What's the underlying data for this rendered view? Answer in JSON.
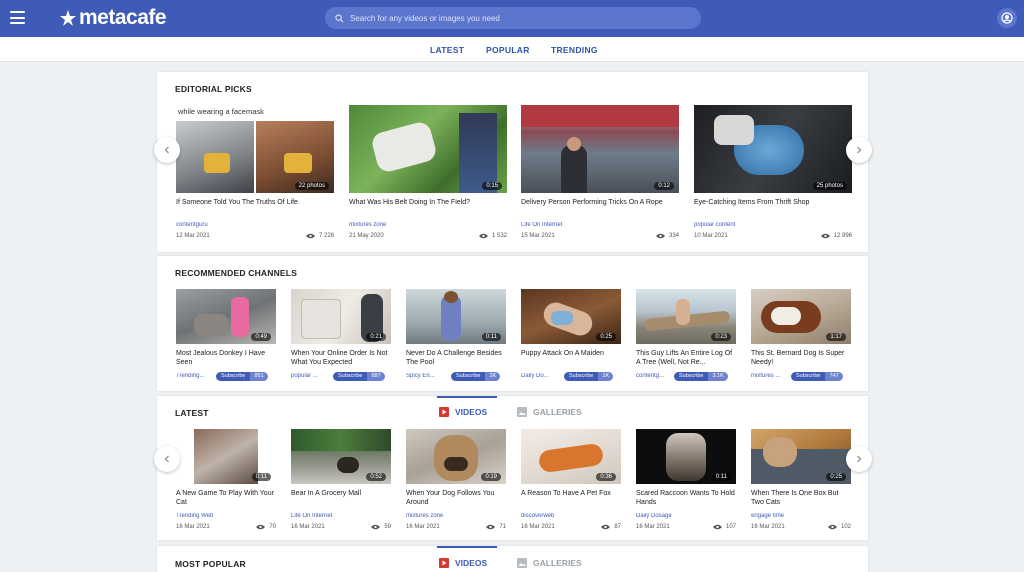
{
  "header": {
    "logo": "metacafe",
    "search_placeholder": "Search for any videos or images you need"
  },
  "subnav": {
    "latest": "LATEST",
    "popular": "POPULAR",
    "trending": "TRENDING"
  },
  "editorial": {
    "title": "EDITORIAL PICKS",
    "items": [
      {
        "title": "If Someone Told You The Truths Of Life",
        "source": "contentguru",
        "date": "12 Mar 2021",
        "views": "7 228",
        "badge": "22 photos",
        "overlay": "while wearing a facemask"
      },
      {
        "title": "What Was His Belt Doing In The Field?",
        "source": "mixtures zone",
        "date": "21 May 2020",
        "views": "1 532",
        "badge": "0:15"
      },
      {
        "title": "Delivery Person Performing Tricks On A Rope",
        "source": "Life On Internet",
        "date": "15 Mar 2021",
        "views": "334",
        "badge": "0:12"
      },
      {
        "title": "Eye-Catching Items From Thrift Shop",
        "source": "popular content",
        "date": "10 Mar 2021",
        "views": "12 996",
        "badge": "25 photos"
      }
    ]
  },
  "channels": {
    "title": "RECOMMENDED CHANNELS",
    "subscribe_label": "Subscribe",
    "items": [
      {
        "title": "Most Jealous Donkey I Have Seen",
        "source": "Trending...",
        "count": "851",
        "badge": "0:49"
      },
      {
        "title": "When Your Online Order Is Not What You Expected",
        "source": "popular ...",
        "count": "887",
        "badge": "0:21"
      },
      {
        "title": "Never Do A Challenge Besides The Pool",
        "source": "Spicy En...",
        "count": "2K",
        "badge": "0:11"
      },
      {
        "title": "Puppy Attack On A Maiden",
        "source": "Daily Do...",
        "count": "1K",
        "badge": "0:25"
      },
      {
        "title": "This Guy Lifts An Entire Log Of A Tree (Well, Not Re...",
        "source": "contentg...",
        "count": "3.1K",
        "badge": "0:23"
      },
      {
        "title": "This St. Bernard Dog Is Super Needy!",
        "source": "mixtures ...",
        "count": "747",
        "badge": "1:17"
      }
    ]
  },
  "latest": {
    "title": "LATEST",
    "tab_videos": "VIDEOS",
    "tab_galleries": "GALLERIES",
    "items": [
      {
        "title": "A New Game To Play With Your Cat",
        "source": "Trending Web",
        "date": "16 Mar 2021",
        "views": "70",
        "badge": "0:11"
      },
      {
        "title": "Bear In A Grocery Mall",
        "source": "Life On Internet",
        "date": "16 Mar 2021",
        "views": "59",
        "badge": "0:52"
      },
      {
        "title": "When Your Dog Follows You Around",
        "source": "mixtures zone",
        "date": "16 Mar 2021",
        "views": "71",
        "badge": "0:19"
      },
      {
        "title": "A Reason To Have A Pet Fox",
        "source": "discoverweb",
        "date": "16 Mar 2021",
        "views": "87",
        "badge": "0:36"
      },
      {
        "title": "Scared Raccoon Wants To Hold Hands",
        "source": "Daily Dosage",
        "date": "16 Mar 2021",
        "views": "107",
        "badge": "0:11"
      },
      {
        "title": "When There Is One Box But Two Cats",
        "source": "engage time",
        "date": "16 Mar 2021",
        "views": "102",
        "badge": "0:25"
      }
    ]
  },
  "popular": {
    "title": "MOST POPULAR",
    "tab_videos": "VIDEOS",
    "tab_galleries": "GALLERIES"
  },
  "colors": {
    "brand": "#3f5bb8",
    "search": "#5b76cc",
    "link": "#2f52b0"
  }
}
